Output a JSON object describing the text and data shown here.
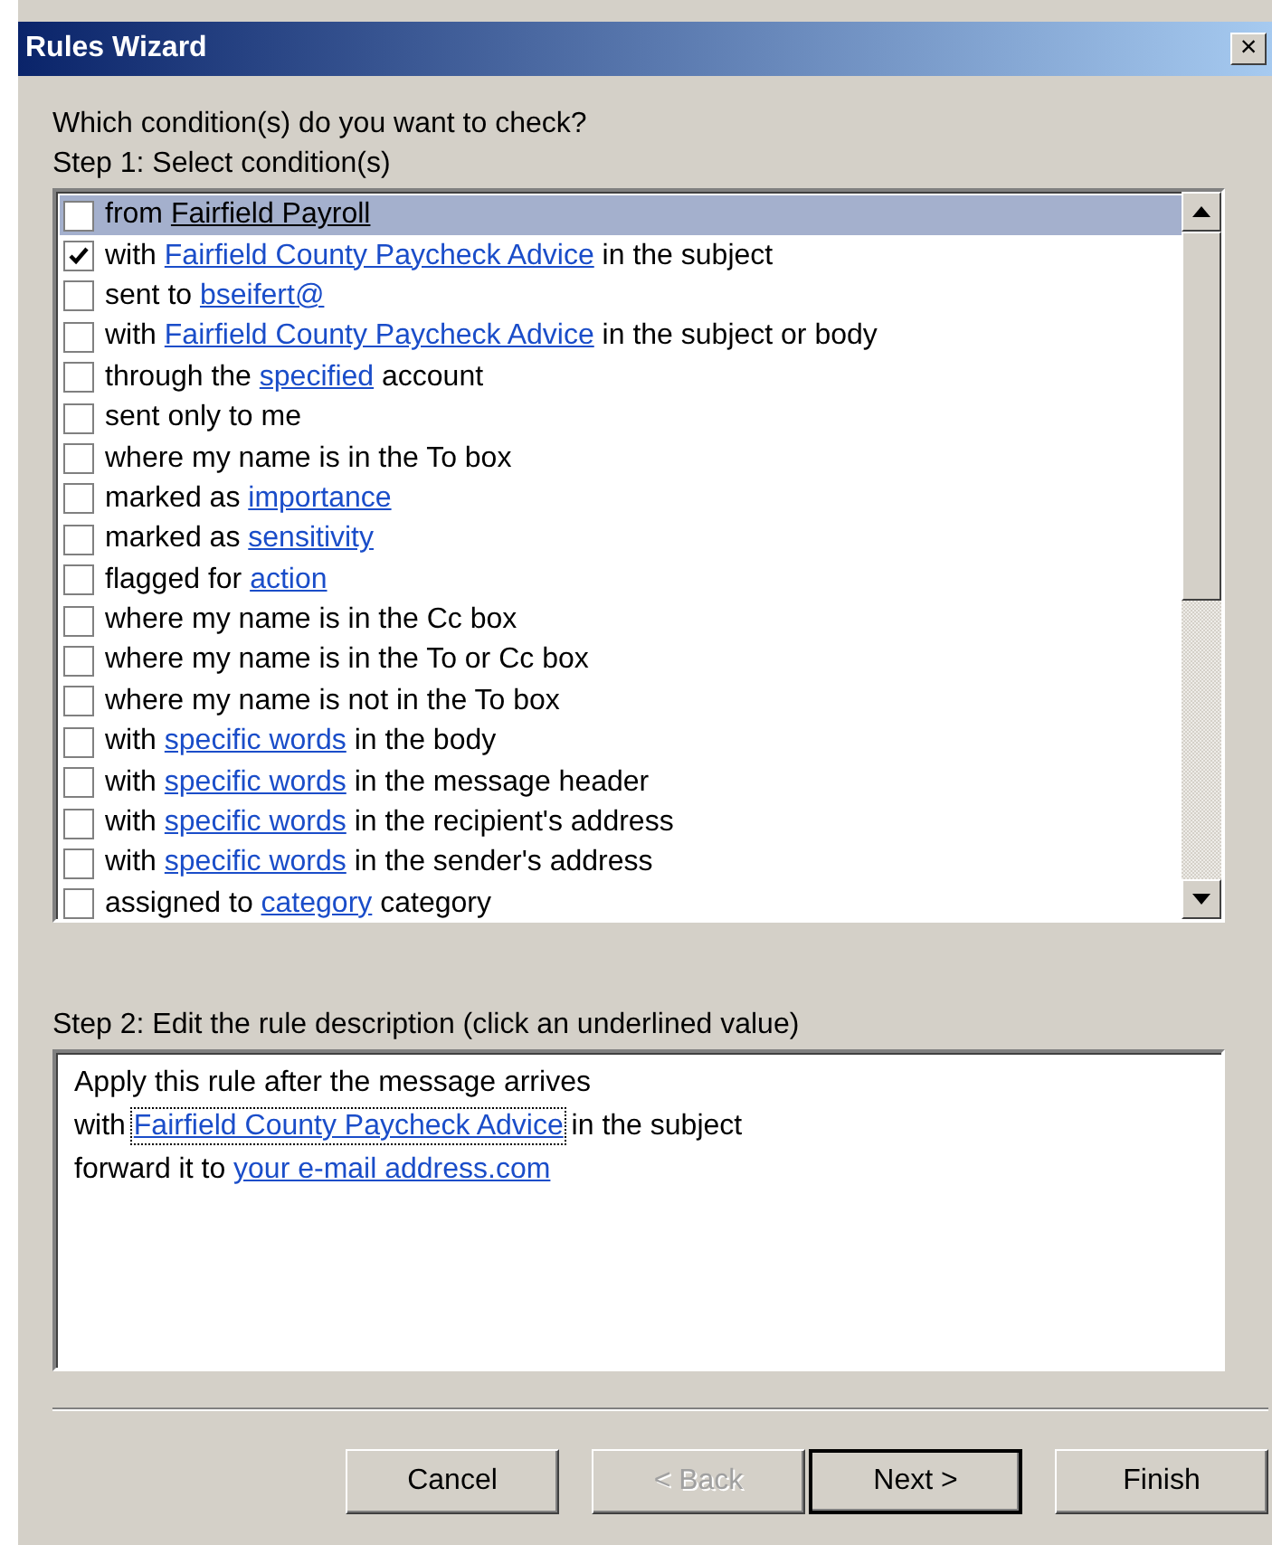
{
  "window": {
    "title": "Rules Wizard",
    "close": "×"
  },
  "question": "Which condition(s) do you want to check?",
  "step1": "Step 1: Select condition(s)",
  "conditions": [
    {
      "checked": false,
      "selected": true,
      "parts": [
        {
          "text": "from "
        },
        {
          "text": "Fairfield Payroll",
          "link": true
        }
      ]
    },
    {
      "checked": true,
      "selected": false,
      "parts": [
        {
          "text": "with "
        },
        {
          "text": "Fairfield County Paycheck Advice",
          "link": true
        },
        {
          "text": " in the subject"
        }
      ]
    },
    {
      "checked": false,
      "selected": false,
      "parts": [
        {
          "text": "sent to "
        },
        {
          "text": "bseifert@",
          "link": true
        }
      ]
    },
    {
      "checked": false,
      "selected": false,
      "parts": [
        {
          "text": "with "
        },
        {
          "text": "Fairfield County Paycheck Advice",
          "link": true
        },
        {
          "text": " in the subject or body"
        }
      ]
    },
    {
      "checked": false,
      "selected": false,
      "parts": [
        {
          "text": "through the "
        },
        {
          "text": "specified",
          "link": true
        },
        {
          "text": " account"
        }
      ]
    },
    {
      "checked": false,
      "selected": false,
      "parts": [
        {
          "text": "sent only to me"
        }
      ]
    },
    {
      "checked": false,
      "selected": false,
      "parts": [
        {
          "text": "where my name is in the To box"
        }
      ]
    },
    {
      "checked": false,
      "selected": false,
      "parts": [
        {
          "text": "marked as "
        },
        {
          "text": "importance",
          "link": true
        }
      ]
    },
    {
      "checked": false,
      "selected": false,
      "parts": [
        {
          "text": "marked as "
        },
        {
          "text": "sensitivity",
          "link": true
        }
      ]
    },
    {
      "checked": false,
      "selected": false,
      "parts": [
        {
          "text": "flagged for "
        },
        {
          "text": "action",
          "link": true
        }
      ]
    },
    {
      "checked": false,
      "selected": false,
      "parts": [
        {
          "text": "where my name is in the Cc box"
        }
      ]
    },
    {
      "checked": false,
      "selected": false,
      "parts": [
        {
          "text": "where my name is in the To or Cc box"
        }
      ]
    },
    {
      "checked": false,
      "selected": false,
      "parts": [
        {
          "text": "where my name is not in the To box"
        }
      ]
    },
    {
      "checked": false,
      "selected": false,
      "parts": [
        {
          "text": "with "
        },
        {
          "text": "specific words",
          "link": true
        },
        {
          "text": " in the body"
        }
      ]
    },
    {
      "checked": false,
      "selected": false,
      "parts": [
        {
          "text": "with "
        },
        {
          "text": "specific words",
          "link": true
        },
        {
          "text": " in the message header"
        }
      ]
    },
    {
      "checked": false,
      "selected": false,
      "parts": [
        {
          "text": "with "
        },
        {
          "text": "specific words",
          "link": true
        },
        {
          "text": " in the recipient's address"
        }
      ]
    },
    {
      "checked": false,
      "selected": false,
      "parts": [
        {
          "text": "with "
        },
        {
          "text": "specific words",
          "link": true
        },
        {
          "text": " in the sender's address"
        }
      ]
    },
    {
      "checked": false,
      "selected": false,
      "parts": [
        {
          "text": "assigned to "
        },
        {
          "text": "category",
          "link": true
        },
        {
          "text": " category"
        }
      ]
    }
  ],
  "step2": "Step 2: Edit the rule description (click an underlined value)",
  "description": [
    {
      "parts": [
        {
          "text": "Apply this rule after the message arrives"
        }
      ]
    },
    {
      "parts": [
        {
          "text": "with "
        },
        {
          "text": "Fairfield County Paycheck Advice",
          "link": true,
          "focused": true
        },
        {
          "text": " in the subject"
        }
      ]
    },
    {
      "parts": [
        {
          "text": "forward it to "
        },
        {
          "text": "your e-mail address.com",
          "link": true
        }
      ]
    }
  ],
  "buttons": [
    {
      "label": "Cancel",
      "disabled": false,
      "default": false
    },
    {
      "label": "< Back",
      "disabled": true,
      "default": false
    },
    {
      "label": "Next >",
      "disabled": false,
      "default": true
    },
    {
      "label": "Finish",
      "disabled": false,
      "default": false
    }
  ]
}
